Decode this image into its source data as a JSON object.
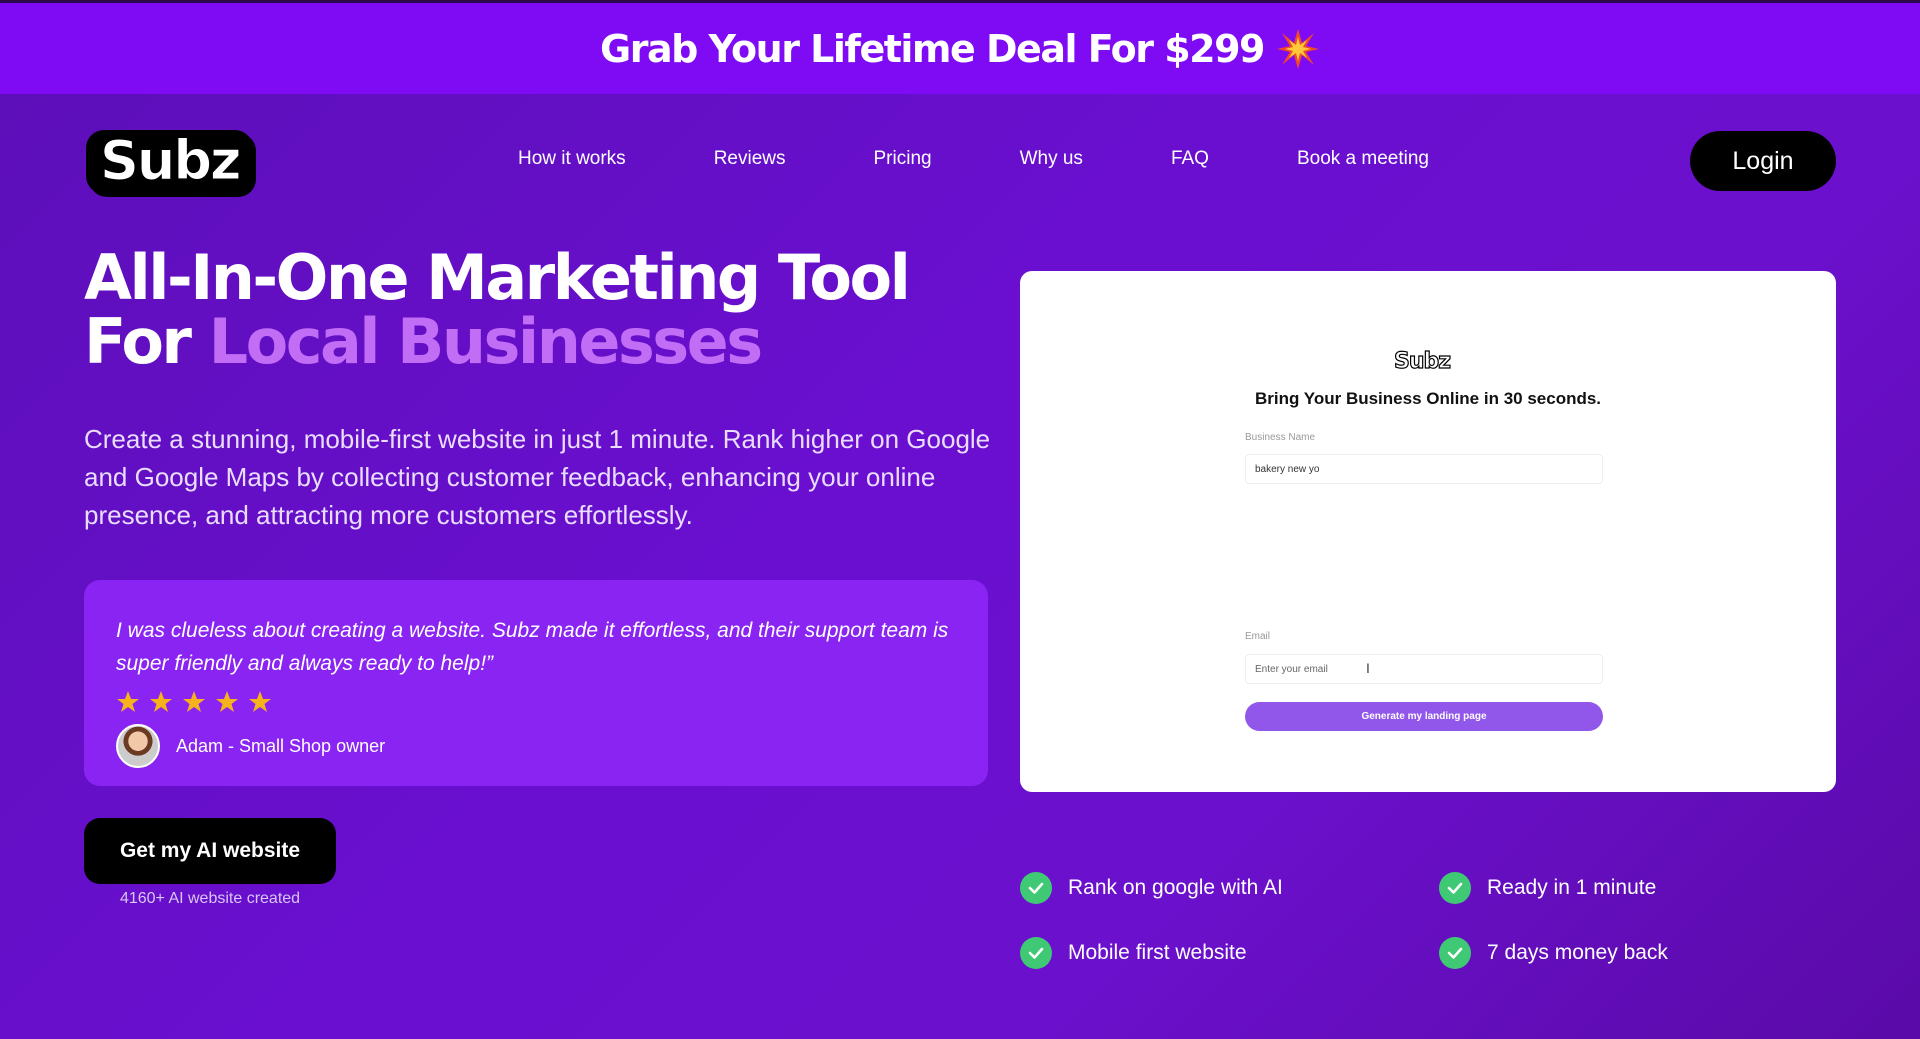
{
  "banner": {
    "text": "Grab Your Lifetime Deal For $299",
    "icon": "burst-icon"
  },
  "header": {
    "logo": "Subz",
    "nav": [
      "How it works",
      "Reviews",
      "Pricing",
      "Why us",
      "FAQ",
      "Book a meeting"
    ],
    "login_label": "Login"
  },
  "hero": {
    "headline_line1": "All-In-One Marketing Tool",
    "headline_for": "For ",
    "headline_accent": "Local Businesses",
    "subtext": "Create a stunning, mobile-first website in just 1 minute. Rank higher on Google and Google Maps by collecting customer feedback, enhancing your online presence, and attracting more customers effortlessly.",
    "cta_label": "Get my AI website",
    "cta_count": "4160+ AI website created"
  },
  "testimonial": {
    "quote": "I was clueless about creating a website. Subz made it effortless, and their support team is super friendly and always ready to help!”",
    "rating": 5,
    "author": "Adam - Small Shop owner"
  },
  "preview": {
    "logo": "Subz",
    "title": "Bring Your Business Online in 30 seconds.",
    "business_label": "Business Name",
    "business_value": "bakery new yo",
    "email_label": "Email",
    "email_placeholder": "Enter your email",
    "button_label": "Generate my landing page"
  },
  "features": [
    "Rank on google with AI",
    "Ready in 1 minute",
    "Mobile first website",
    "7 days money back"
  ],
  "colors": {
    "banner": "#7f0bf5",
    "accent_text": "#c16df5",
    "testimonial_bg": "#8a24f2",
    "check": "#3fc974",
    "preview_button": "#9156ea"
  }
}
